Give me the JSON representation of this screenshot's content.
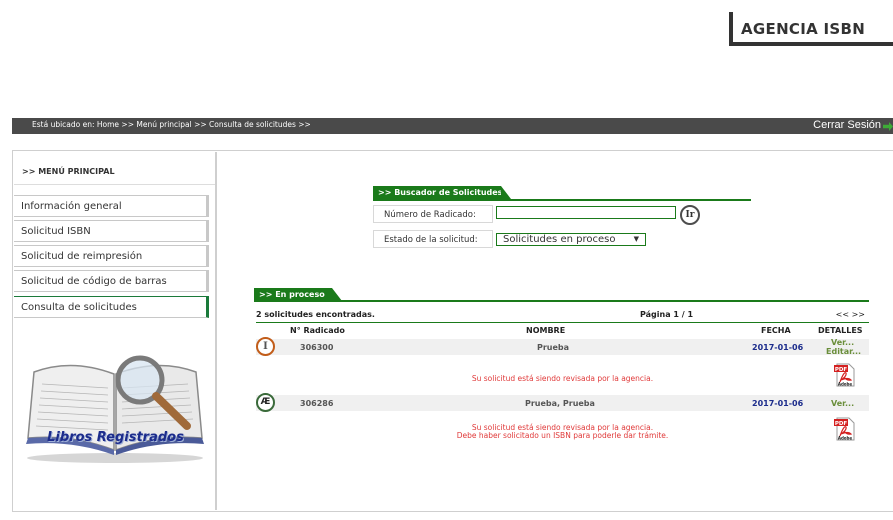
{
  "header": {
    "title": "AGENCIA ISBN"
  },
  "topbar": {
    "breadcrumb": "Está ubicado en: Home >> Menú principal >> Consulta de solicitudes >>",
    "logout_label": "Cerrar Sesión"
  },
  "sidebar": {
    "title": ">> MENÚ PRINCIPAL",
    "items": [
      {
        "label": "Información general"
      },
      {
        "label": "Solicitud ISBN"
      },
      {
        "label": "Solicitud de reimpresión"
      },
      {
        "label": "Solicitud de código de barras"
      },
      {
        "label": "Consulta de solicitudes"
      }
    ],
    "image_caption": "Libros Registrados"
  },
  "search": {
    "tab_label": ">> Buscador de Solicitudes",
    "radicado_label": "Número de Radicado:",
    "radicado_value": "",
    "go_button": "Ir",
    "estado_label": "Estado de la solicitud:",
    "estado_selected": "Solicitudes en proceso"
  },
  "results": {
    "tab_label": ">> En proceso",
    "summary": "2 solicitudes encontradas.",
    "page_info": "Página 1 / 1",
    "pager": "<< >>",
    "columns": {
      "radicado": "N° Radicado",
      "nombre": "NOMBRE",
      "fecha": "FECHA",
      "detalles": "DETALLES"
    },
    "rows": [
      {
        "status_icon": "I",
        "radicado": "306300",
        "nombre": "Prueba",
        "fecha": "2017-01-06",
        "link_ver": "Ver...",
        "link_editar": "Editar...",
        "message_1": "Su solicitud está siendo revisada por la agencia.",
        "message_2": ""
      },
      {
        "status_icon": "Æ",
        "radicado": "306286",
        "nombre": "Prueba, Prueba",
        "fecha": "2017-01-06",
        "link_ver": "Ver...",
        "message_1": "Su solicitud está siendo revisada por la agencia.",
        "message_2": "Debe haber solicitado un ISBN para poderle dar trámite."
      }
    ],
    "pdf_label": "PDF",
    "pdf_brand": "Adobe"
  },
  "colors": {
    "accent_green": "#1a7a1a",
    "topbar_gray": "#4a4a4a",
    "message_red": "#e03a3a",
    "date_blue": "#1c2c8c"
  }
}
